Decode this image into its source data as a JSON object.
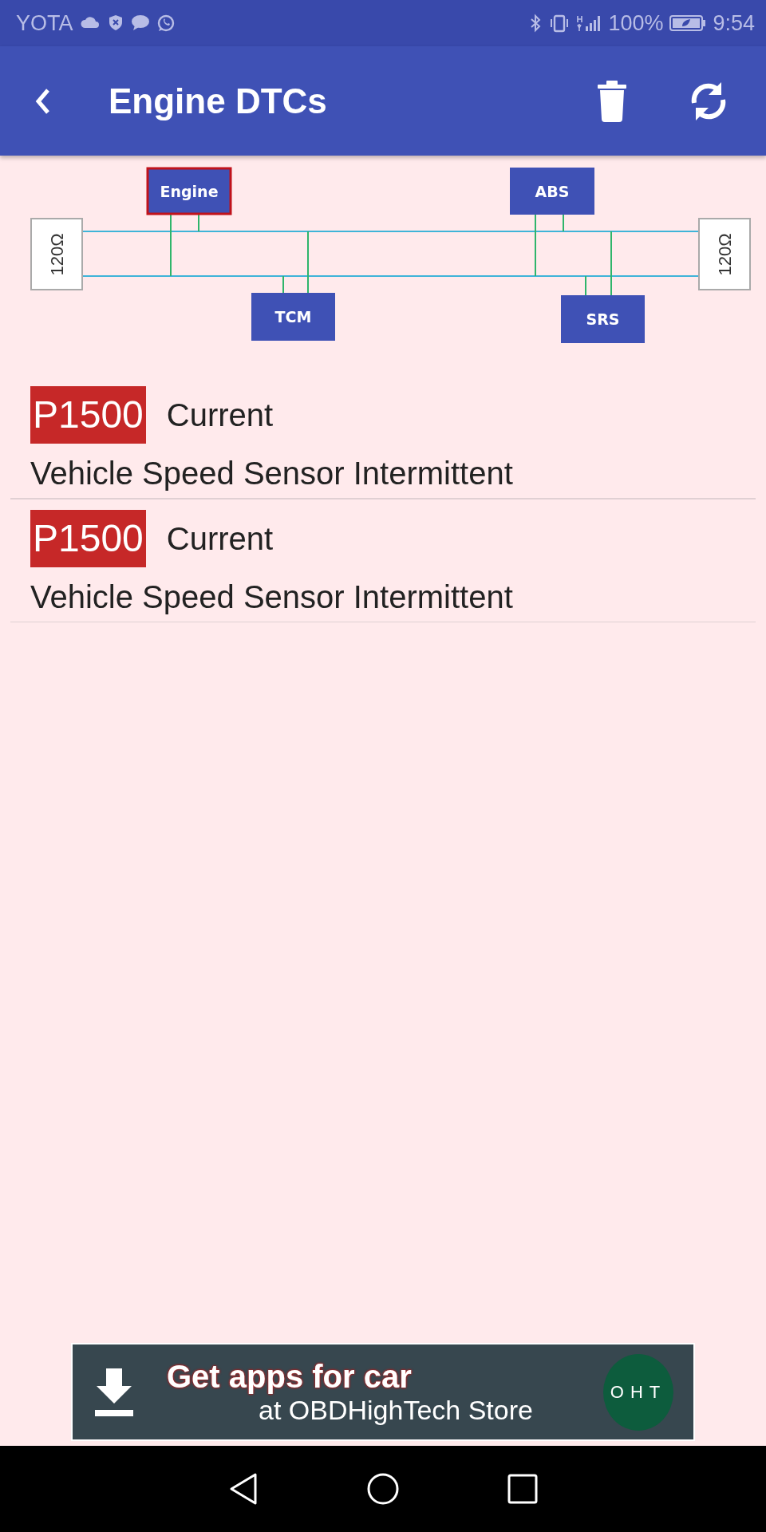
{
  "status_bar": {
    "carrier": "YOTA",
    "battery": "100%",
    "time": "9:54"
  },
  "app_bar": {
    "title": "Engine DTCs"
  },
  "bus_diagram": {
    "terminators": [
      "120Ω",
      "120Ω"
    ],
    "modules": [
      {
        "label": "Engine",
        "selected": true
      },
      {
        "label": "ABS",
        "selected": false
      },
      {
        "label": "TCM",
        "selected": false
      },
      {
        "label": "SRS",
        "selected": false
      }
    ]
  },
  "dtcs": [
    {
      "code": "P1500",
      "status": "Current",
      "description": "Vehicle Speed Sensor Intermittent"
    },
    {
      "code": "P1500",
      "status": "Current",
      "description": "Vehicle Speed Sensor Intermittent"
    }
  ],
  "banner": {
    "headline": "Get apps for car",
    "subline": "at OBDHighTech Store",
    "logo": "OHT"
  }
}
